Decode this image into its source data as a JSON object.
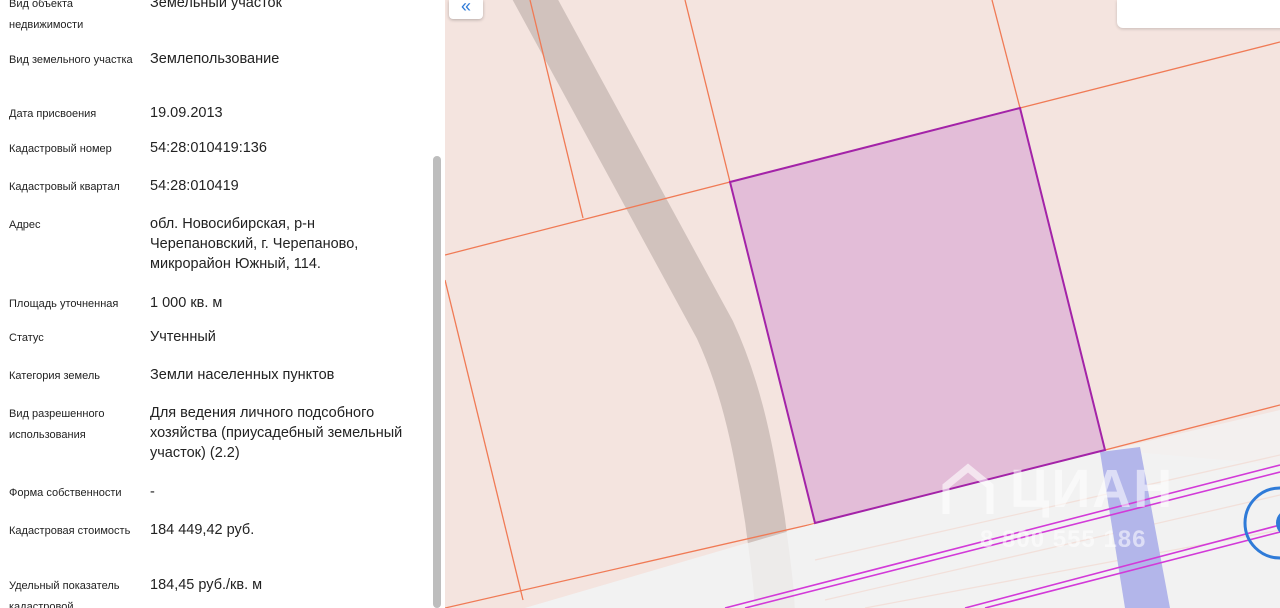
{
  "properties": [
    {
      "label": "Вид объекта недвижимости",
      "value": "Земельный участок"
    },
    {
      "label": "Вид земельного участка",
      "value": "Землепользование"
    },
    {
      "label": "Дата присвоения",
      "value": "19.09.2013"
    },
    {
      "label": "Кадастровый номер",
      "value": "54:28:010419:136"
    },
    {
      "label": "Кадастровый квартал",
      "value": "54:28:010419"
    },
    {
      "label": "Адрес",
      "value": "обл. Новосибирская, р-н Черепановский, г. Черепаново, микрорайон Южный, 114."
    },
    {
      "label": "Площадь уточненная",
      "value": "1 000 кв. м"
    },
    {
      "label": "Статус",
      "value": "Учтенный"
    },
    {
      "label": "Категория земель",
      "value": "Земли населенных пунктов"
    },
    {
      "label": "Вид разрешенного использования",
      "value": "Для ведения личного подсобного хозяйства (приусадебный земельный участок) (2.2)"
    },
    {
      "label": "Форма собственности",
      "value": "-"
    },
    {
      "label": "Кадастровая стоимость",
      "value": "184 449,42 руб."
    },
    {
      "label": "Удельный показатель кадастровой",
      "value": "184,45 руб./кв. м"
    }
  ],
  "map": {
    "collapse_icon": "«",
    "colors": {
      "background": "#f2f2f2",
      "parcel_fill": "#f4e4df",
      "parcel_border": "#f07a55",
      "selected_fill": "#e3bdd8",
      "selected_border": "#a323a8",
      "road": "#d1c2bd",
      "blue_strip": "#b3b6ea",
      "magenta_line": "#d23ad8"
    },
    "watermark_text": "ЦИАН",
    "watermark_number": "8 800 555 186"
  }
}
